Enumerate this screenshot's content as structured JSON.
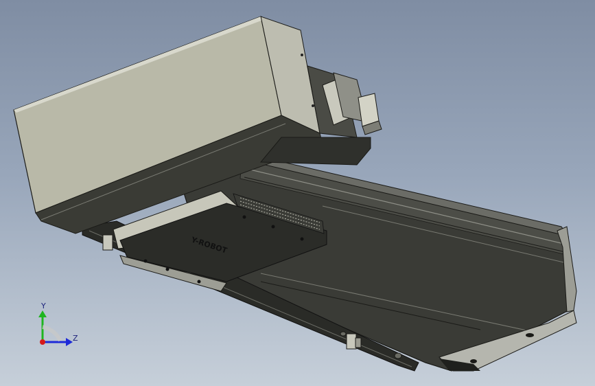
{
  "viewport": {
    "colors": {
      "bg_top": "#7f8da3",
      "bg_bottom": "#c6cfd9",
      "housing": "#b9b9a8",
      "body_dark": "#2f302c",
      "edge": "#1a1a17"
    }
  },
  "part": {
    "brand_text": "Y-ROBOT"
  },
  "triad": {
    "y_label": "Y",
    "z_label": "Z",
    "colors": {
      "y_axis": "#1fb51f",
      "z_axis": "#1d2ad8",
      "origin": "#d61a1a"
    }
  }
}
